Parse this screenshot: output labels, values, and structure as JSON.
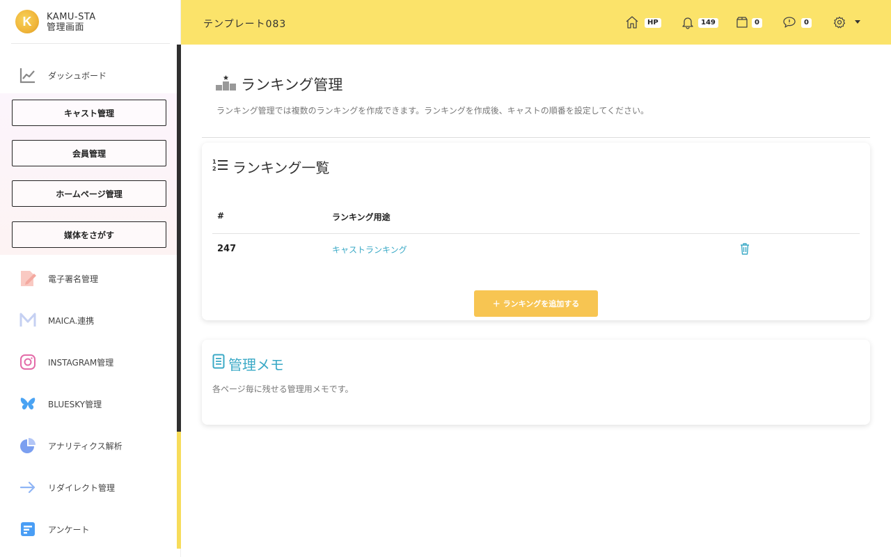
{
  "brand": {
    "logo_letter": "K",
    "name": "KAMU-STA",
    "subtitle": "管理画面"
  },
  "header": {
    "title": "テンプレート083",
    "hp_badge": "HP",
    "notifications_count": "149",
    "box_count": "0",
    "messages_count": "0"
  },
  "sidebar": {
    "dashboard": "ダッシュボード",
    "group_buttons": [
      "キャスト管理",
      "会員管理",
      "ホームページ管理",
      "媒体をさがす"
    ],
    "items": [
      {
        "label": "電子署名管理",
        "icon": "signature-icon",
        "color": "#f4a9a0"
      },
      {
        "label": "MAICA.連携",
        "icon": "maica-m-icon",
        "color": "#b9c6ef"
      },
      {
        "label": "INSTAGRAM管理",
        "icon": "instagram-icon",
        "color": "#e36ba8"
      },
      {
        "label": "BLUESKY管理",
        "icon": "butterfly-icon",
        "color": "#4aa3f3"
      },
      {
        "label": "アナリティクス解析",
        "icon": "pie-chart-icon",
        "color": "#7b9ff0"
      },
      {
        "label": "リダイレクト管理",
        "icon": "arrow-right-icon",
        "color": "#8fb5f5"
      },
      {
        "label": "アンケート",
        "icon": "survey-icon",
        "color": "#4a9ef5"
      }
    ]
  },
  "page": {
    "title": "ランキング管理",
    "description": "ランキング管理では複数のランキングを作成できます。ランキングを作成後、キャストの順番を設定してください。"
  },
  "ranking_list": {
    "title": "ランキング一覧",
    "columns": [
      "#",
      "ランキング用途"
    ],
    "rows": [
      {
        "id": "247",
        "purpose": "キャストランキング"
      }
    ],
    "add_button": "＋ ランキングを追加する"
  },
  "memo": {
    "title": "管理メモ",
    "description": "各ページ毎に残せる管理用メモです。"
  },
  "colors": {
    "accent_yellow": "#fbe36a",
    "link_teal": "#3aa9c6",
    "button_orange": "#f7c552"
  }
}
